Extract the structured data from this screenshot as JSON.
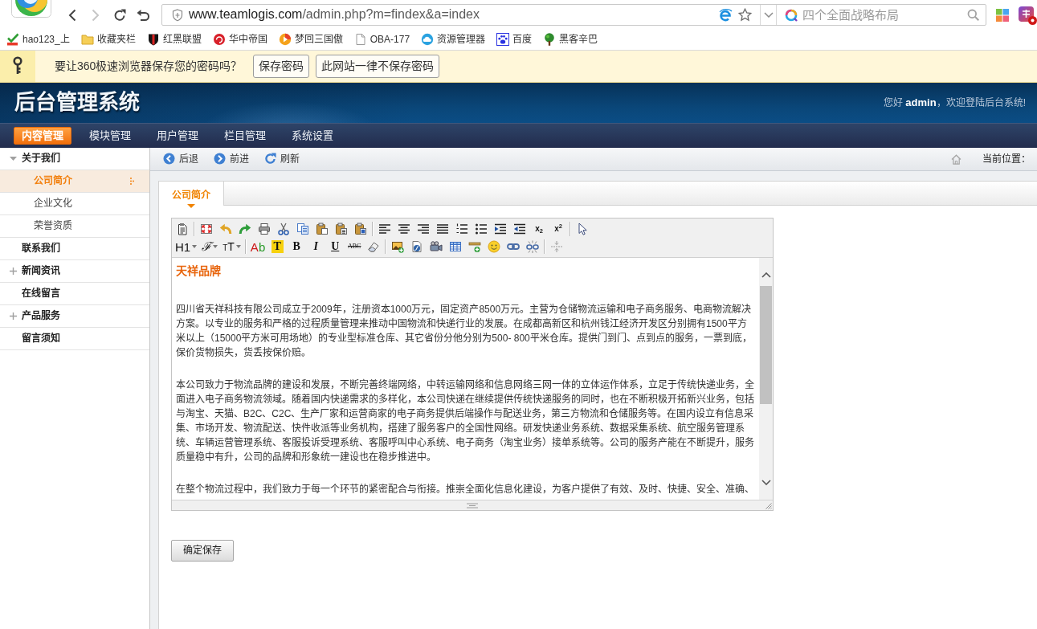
{
  "browser": {
    "nav_buttons": [
      {
        "kind": "back",
        "disabled": false
      },
      {
        "kind": "forward",
        "disabled": true
      },
      {
        "kind": "reload",
        "disabled": false
      },
      {
        "kind": "restore",
        "disabled": false
      }
    ],
    "address": {
      "host": "www.teamlogis.com",
      "path": "/admin.php?m=findex&a=index"
    },
    "search": {
      "placeholder": "四个全面战略布局"
    },
    "bookmarks": [
      {
        "label": "hao123_上"
      },
      {
        "label": "收藏夹栏"
      },
      {
        "label": "红黑联盟"
      },
      {
        "label": "华中帝国"
      },
      {
        "label": "梦回三国傲"
      },
      {
        "label": "OBA-177"
      },
      {
        "label": "资源管理器"
      },
      {
        "label": "百度"
      },
      {
        "label": "黑客辛巴"
      }
    ],
    "password_prompt": {
      "message": "要让360极速浏览器保存您的密码吗？",
      "buttons": [
        "保存密码",
        "此网站一律不保存密码"
      ]
    }
  },
  "header": {
    "title": "后台管理系统",
    "greeting": "您好 **admin**，欢迎登陆后台系统!"
  },
  "menu": [
    {
      "label": "内容管理",
      "selected": true
    },
    {
      "label": "模块管理",
      "selected": false
    },
    {
      "label": "用户管理",
      "selected": false
    },
    {
      "label": "栏目管理",
      "selected": false
    },
    {
      "label": "系统设置",
      "selected": false
    }
  ],
  "sidebar": {
    "items": [
      {
        "label": "关于我们",
        "kind": "group",
        "expanded": true,
        "selected": false,
        "children": [
          {
            "label": "公司简介",
            "selected": true
          },
          {
            "label": "企业文化",
            "selected": false
          },
          {
            "label": "荣誉资质",
            "selected": false
          }
        ]
      },
      {
        "label": "联系我们",
        "kind": "link",
        "selected": false
      },
      {
        "label": "新闻资讯",
        "kind": "group",
        "expanded": false,
        "selected": false
      },
      {
        "label": "在线留言",
        "kind": "link",
        "selected": false
      },
      {
        "label": "产品服务",
        "kind": "group",
        "expanded": false,
        "selected": false
      },
      {
        "label": "留言须知",
        "kind": "link",
        "selected": false
      }
    ]
  },
  "toolbar": {
    "buttons": [
      {
        "kind": "back",
        "label": "后退"
      },
      {
        "kind": "forward",
        "label": "前进"
      },
      {
        "kind": "refresh",
        "label": "刷新"
      }
    ],
    "location_label": "当前位置："
  },
  "tabs": [
    {
      "label": "公司简介",
      "selected": true
    }
  ],
  "editor": {
    "text_buttons": [
      {
        "kind": "subscript",
        "label": "x$_{2}$"
      },
      {
        "kind": "superscript",
        "label": "x$^{2}$"
      },
      {
        "kind": "heading-menu",
        "label": "H1"
      },
      {
        "kind": "font-menu",
        "label": "ℱ"
      },
      {
        "kind": "size-menu",
        "label": "TT"
      },
      {
        "kind": "text-color",
        "label": "Ab"
      },
      {
        "kind": "highlight",
        "label": "T"
      },
      {
        "kind": "bold",
        "label": "B"
      },
      {
        "kind": "italic",
        "label": "I"
      },
      {
        "kind": "underline",
        "label": "U"
      },
      {
        "kind": "strikethrough",
        "label": "ABC"
      }
    ],
    "heading": "天祥品牌",
    "paragraphs": [
      "四川省天祥科技有限公司成立于2009年，注册资本1000万元，固定资产8500万元。主营为仓储物流运输和电子商务服务、电商物流解决方案。以专业的服务和严格的过程质量管理来推动中国物流和快递行业的发展。在成都高新区和杭州钱江经济开发区分别拥有1500平方米以上（15000平方米可用场地）的专业型标准仓库、其它省份分他分别为500- 800平米仓库。提供门到门、点到点的服务，一票到底，保价货物损失，货丢按保价赔。",
      "本公司致力于物流品牌的建设和发展，不断完善终端网络，中转运输网络和信息网络三网一体的立体运作体系，立足于传统快递业务，全面进入电子商务物流领域。随着国内快递需求的多样化，本公司快递在继续提供传统快递服务的同时，也在不断积极开拓新兴业务，包括与淘宝、天猫、B2C、C2C、生产厂家和运营商家的电子商务提供后端操作与配送业务，第三方物流和仓储服务等。在国内设立有信息采集、市场开发、物流配送、快件收派等业务机构，搭建了服务客户的全国性网络。研发快递业务系统、数据采集系统、航空服务管理系统、车辆运营管理系统、客服投诉受理系统、客服呼叫中心系统、电子商务（淘宝业务）接单系统等。公司的服务产能在不断提升，服务质量稳中有升，公司的品牌和形象统一建设也在稳步推进中。",
      "在整个物流过程中，我们致力于每一个环节的紧密配合与衔接。推崇全面化信息化建设，为客户提供了有效、及时、快捷、安全、准确、"
    ]
  },
  "save_button": "确定保存"
}
